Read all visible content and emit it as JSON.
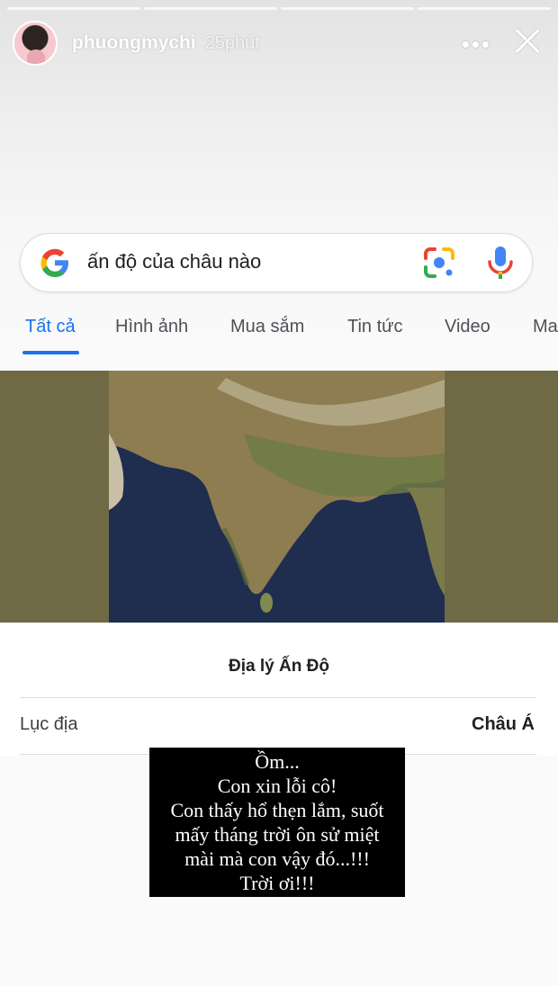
{
  "story": {
    "progress_segments": 4,
    "username": "phuongmychi",
    "time": "25phút"
  },
  "search": {
    "query": "ấn độ của châu nào",
    "icons": [
      "google-g-icon",
      "lens-icon",
      "mic-icon"
    ]
  },
  "tabs": [
    {
      "label": "Tất cả",
      "active": true
    },
    {
      "label": "Hình ảnh",
      "active": false
    },
    {
      "label": "Mua sắm",
      "active": false
    },
    {
      "label": "Tin tức",
      "active": false
    },
    {
      "label": "Video",
      "active": false
    },
    {
      "label": "Ma",
      "active": false
    }
  ],
  "knowledge_card": {
    "title": "Địa lý Ấn Độ",
    "row_label": "Lục địa",
    "row_value": "Châu Á"
  },
  "caption": {
    "lines": [
      "Ồm...",
      "Con xin lỗi cô!",
      "Con thấy hổ thẹn lắm, suốt",
      "mấy tháng trời ôn sử miệt",
      "mài mà con vậy đó...!!!",
      "Trời ơi!!!"
    ]
  },
  "colors": {
    "accent": "#1a73e8",
    "map_band": "#6f6a45",
    "ocean": "#1f2d4f",
    "land": "#8f7d52"
  }
}
